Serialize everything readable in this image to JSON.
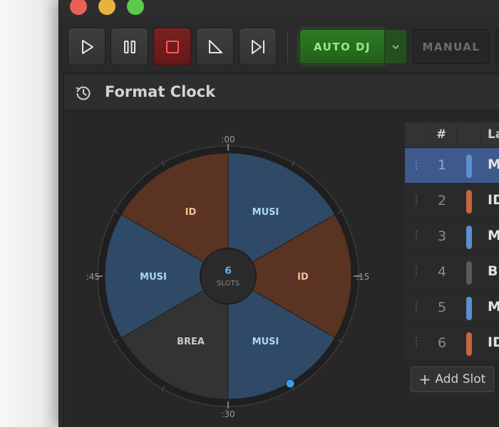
{
  "window": {
    "title_bar": "traffic-lights"
  },
  "toolbar": {
    "buttons": [
      {
        "name": "play",
        "icon": "play-icon"
      },
      {
        "name": "pause",
        "icon": "pause-icon"
      },
      {
        "name": "stop",
        "icon": "stop-icon",
        "color": "#7a2020"
      },
      {
        "name": "fade",
        "icon": "fade-ramp-icon"
      },
      {
        "name": "skip",
        "icon": "skip-next-icon"
      }
    ],
    "auto_dj_label": "AUTO DJ",
    "manual_label": "MANUAL"
  },
  "panel": {
    "title": "Format Clock",
    "icon": "history-icon"
  },
  "clock": {
    "tick_labels": [
      ":00",
      ":15",
      ":30",
      ":45"
    ],
    "center_count": "6",
    "center_caption": "SLOTS",
    "segments": [
      {
        "label": "MUSI",
        "type": "music",
        "color": "#2f4a66",
        "text_color": "#a9d8f5"
      },
      {
        "label": "ID",
        "type": "id",
        "color": "#5a3323",
        "text_color": "#f0c39c"
      },
      {
        "label": "MUSI",
        "type": "music",
        "color": "#2f4a66",
        "text_color": "#a9d8f5"
      },
      {
        "label": "BREA",
        "type": "break",
        "color": "#333333",
        "text_color": "#c8c8c8"
      },
      {
        "label": "MUSI",
        "type": "music",
        "color": "#2f4a66",
        "text_color": "#a9d8f5"
      },
      {
        "label": "ID",
        "type": "id",
        "color": "#5a3323",
        "text_color": "#f0c39c"
      }
    ],
    "playhead_color": "#3aa0e8"
  },
  "table": {
    "headers": {
      "num": "#",
      "label": "La"
    },
    "rows": [
      {
        "num": "1",
        "label": "M",
        "color": "#5b8fd0",
        "selected": true
      },
      {
        "num": "2",
        "label": "ID",
        "color": "#c8663f",
        "selected": false
      },
      {
        "num": "3",
        "label": "M",
        "color": "#5b8fd0",
        "selected": false
      },
      {
        "num": "4",
        "label": "Br",
        "color": "#5a5a5a",
        "selected": false
      },
      {
        "num": "5",
        "label": "M",
        "color": "#5b8fd0",
        "selected": false
      },
      {
        "num": "6",
        "label": "ID",
        "color": "#c8663f",
        "selected": false
      }
    ],
    "add_slot_label": "Add Slot"
  }
}
